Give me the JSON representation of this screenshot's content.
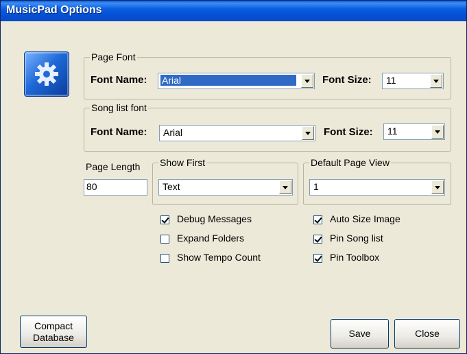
{
  "window": {
    "title": "MusicPad Options"
  },
  "page_font": {
    "legend": "Page Font",
    "font_name_label": "Font Name:",
    "font_name_value": "Arial",
    "font_size_label": "Font Size:",
    "font_size_value": "11"
  },
  "song_list_font": {
    "legend": "Song list font",
    "font_name_label": "Font Name:",
    "font_name_value": "Arial",
    "font_size_label": "Font Size:",
    "font_size_value": "11"
  },
  "page_length": {
    "label": "Page Length",
    "value": "80"
  },
  "show_first": {
    "legend": "Show First",
    "value": "Text"
  },
  "default_page_view": {
    "legend": "Default Page View",
    "value": "1"
  },
  "checkboxes_left": [
    {
      "label": "Debug Messages",
      "checked": true
    },
    {
      "label": "Expand Folders",
      "checked": false
    },
    {
      "label": "Show Tempo Count",
      "checked": false
    }
  ],
  "checkboxes_right": [
    {
      "label": "Auto Size Image",
      "checked": true
    },
    {
      "label": "Pin Song list",
      "checked": true
    },
    {
      "label": "Pin Toolbox",
      "checked": true
    }
  ],
  "buttons": {
    "compact_line1": "Compact",
    "compact_line2": "Database",
    "save": "Save",
    "close": "Close"
  },
  "icons": {
    "settings": "gear-icon"
  }
}
